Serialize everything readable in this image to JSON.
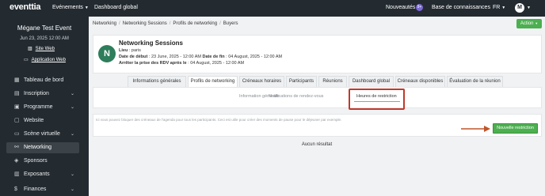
{
  "topbar": {
    "logo": "eventtia",
    "events_menu": "Evénements",
    "dashboard": "Dashboard global",
    "nouveautes": "Nouveautés",
    "nouveautes_badge": "9+",
    "knowledge_base": "Base de connaissances",
    "language": "FR",
    "avatar_initial": "M"
  },
  "sidebar": {
    "event_title": "Mégane Test Event",
    "event_date": "Jun 23, 2025 12:00 AM",
    "site_web": "Site Web",
    "app_web": "Application Web",
    "items": [
      {
        "label": "Tableau de bord",
        "icon": "grid-icon",
        "glyph": "▦",
        "chevron": false
      },
      {
        "label": "Inscription",
        "icon": "person-icon",
        "glyph": "▤",
        "chevron": true
      },
      {
        "label": "Programme",
        "icon": "calendar-icon",
        "glyph": "▣",
        "chevron": true
      },
      {
        "label": "Website",
        "icon": "page-icon",
        "glyph": "▢",
        "chevron": false
      },
      {
        "label": "Scène virtuelle",
        "icon": "display-icon",
        "glyph": "▭",
        "chevron": true
      },
      {
        "label": "Networking",
        "icon": "network-icon",
        "glyph": "⚯",
        "chevron": false,
        "active": true
      },
      {
        "label": "Sponsors",
        "icon": "sponsor-icon",
        "glyph": "◈",
        "chevron": false
      },
      {
        "label": "Exposants",
        "icon": "exhibitor-icon",
        "glyph": "▥",
        "chevron": true
      },
      {
        "label": "Finances",
        "icon": "dollar-icon",
        "glyph": "$",
        "chevron": true
      }
    ]
  },
  "breadcrumb": [
    "Networking",
    "Networking Sessions",
    "Profils de networking",
    "Buyers"
  ],
  "action_button": "Action",
  "event_card": {
    "initial": "N",
    "title": "Networking Sessions",
    "lieu_label": "Lieu",
    "lieu_value": ": paris",
    "debut_label": "Date de début",
    "debut_value": ": 23 June, 2025 - 12:00 AM",
    "fin_label": "Date de fin",
    "fin_value": ": 04 August, 2025 - 12:00 AM",
    "arret_label": "Arrêter la prise des RDV après le",
    "arret_value": ": 04 August, 2025 - 12:00 AM"
  },
  "tabs": [
    "Informations générales",
    "Profils de networking",
    "Créneaux horaires",
    "Participants",
    "Réunions",
    "Dashboard global",
    "Créneaux disponibles",
    "Évaluation de la réunion"
  ],
  "active_tab": 1,
  "subtabs": [
    "Information générale",
    "Notifications de rendez-vous",
    "Heures de restriction"
  ],
  "active_subtab": 2,
  "info_text": "Ici vous pouvez bloquer des créneaux de l'agenda pour tous les participants. Ceci est utile pour créer des moments de pause pour le déjeuner par exemple.",
  "new_button": "Nouvelle restriction",
  "empty_text": "Aucun résultat",
  "colors": {
    "sidebar_bg": "#232b31",
    "accent_green": "#4caf50",
    "highlight_red": "#c0392b",
    "arrow_orange": "#c0552b"
  }
}
